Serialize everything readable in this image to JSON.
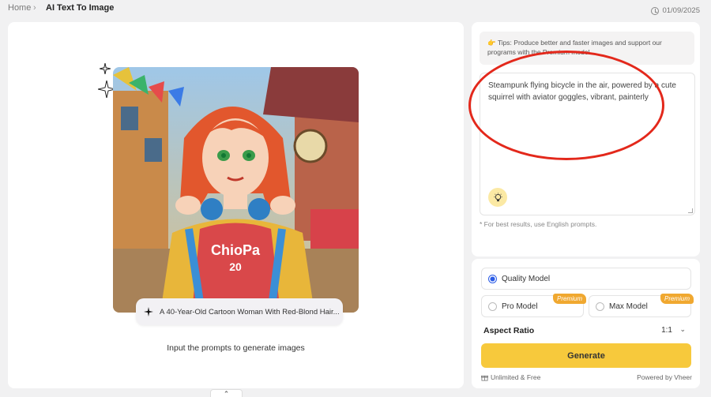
{
  "breadcrumb": {
    "home": "Home",
    "separator": "›",
    "current": "AI Text To Image"
  },
  "date": "01/09/2025",
  "left": {
    "prompt_chip": "A 40-Year-Old Cartoon Woman With Red-Blond Hair...",
    "caption": "Input the prompts to generate images",
    "image_shirt_text": "ChioPa",
    "image_shirt_number": "20",
    "bottom_tab": "⌃"
  },
  "tips": {
    "text": "Tips: Produce better and faster images and support our programs with the Premium model."
  },
  "prompt": {
    "text": "Steampunk flying bicycle in the air, powered by a cute squirrel with aviator goggles, vibrant, painterly"
  },
  "best_note": "* For best results, use English prompts.",
  "models": {
    "quality": "Quality Model",
    "pro": "Pro Model",
    "max": "Max Model",
    "premium_badge": "Premium",
    "selected": "quality"
  },
  "aspect": {
    "label": "Aspect Ratio",
    "value": "1:1"
  },
  "generate_label": "Generate",
  "footer": {
    "unlimited": "Unlimited & Free",
    "powered": "Powered by Vheer"
  },
  "colors": {
    "accent": "#f7c93c",
    "radio": "#2b5ce6",
    "premium": "#f0a830",
    "annotation": "#e3281b"
  }
}
